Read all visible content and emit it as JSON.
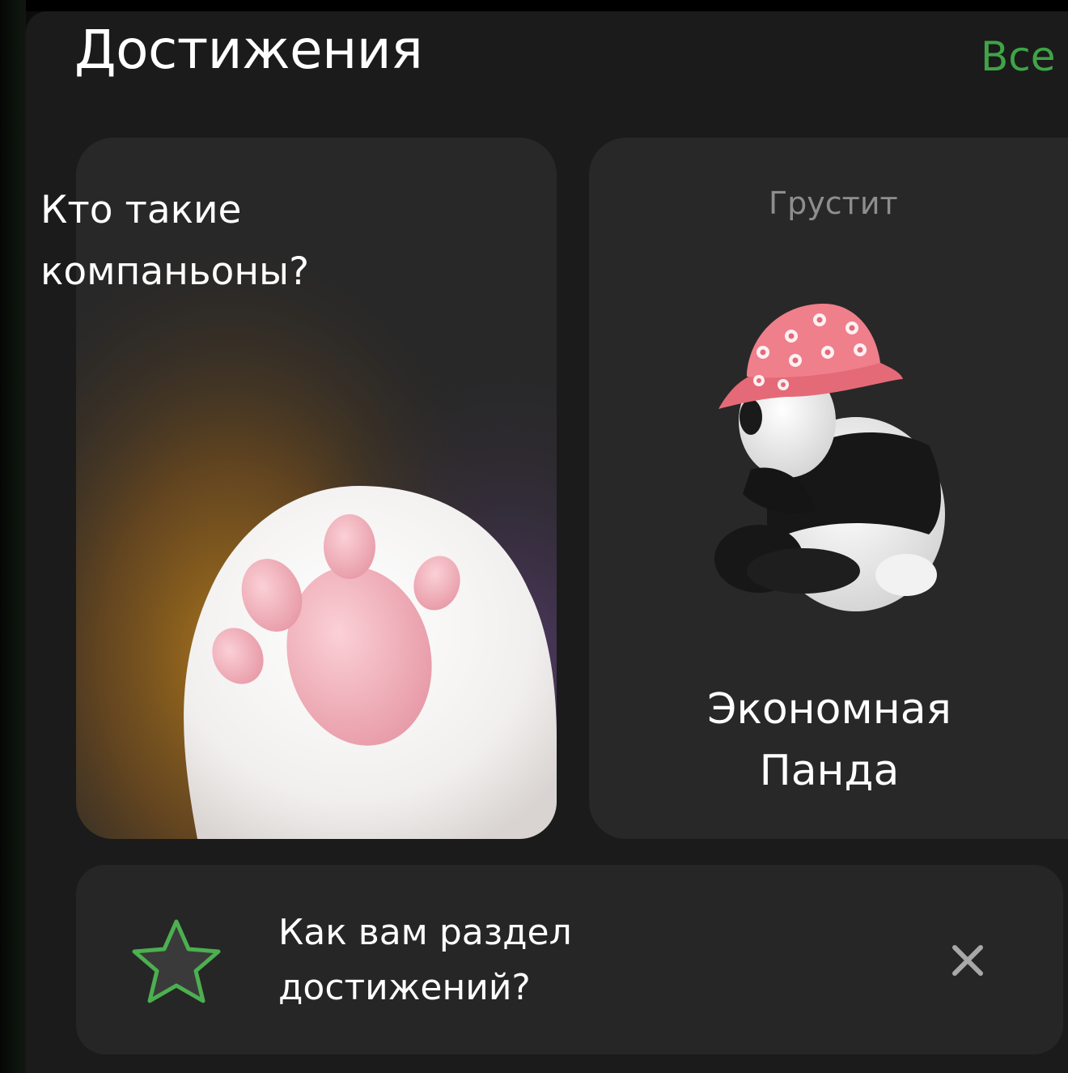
{
  "header": {
    "title": "Достижения",
    "all_link": "Все"
  },
  "cards": {
    "companions": {
      "title_line1": "Кто такие",
      "title_line2": "компаньоны?",
      "image_icon": "cat-paw-icon"
    },
    "panda": {
      "status": "Грустит",
      "name_line1": "Экономная",
      "name_line2": "Панда",
      "image_icon": "panda-in-bucket-hat-icon"
    }
  },
  "feedback": {
    "line1": "Как вам раздел",
    "line2": "достижений?",
    "icon": "star-icon",
    "close_icon": "close-icon"
  },
  "colors": {
    "background": "#1b1b1b",
    "card": "#282828",
    "accent_green": "#3fa447",
    "text_primary": "#ffffff",
    "text_secondary": "#8e8e8e"
  }
}
